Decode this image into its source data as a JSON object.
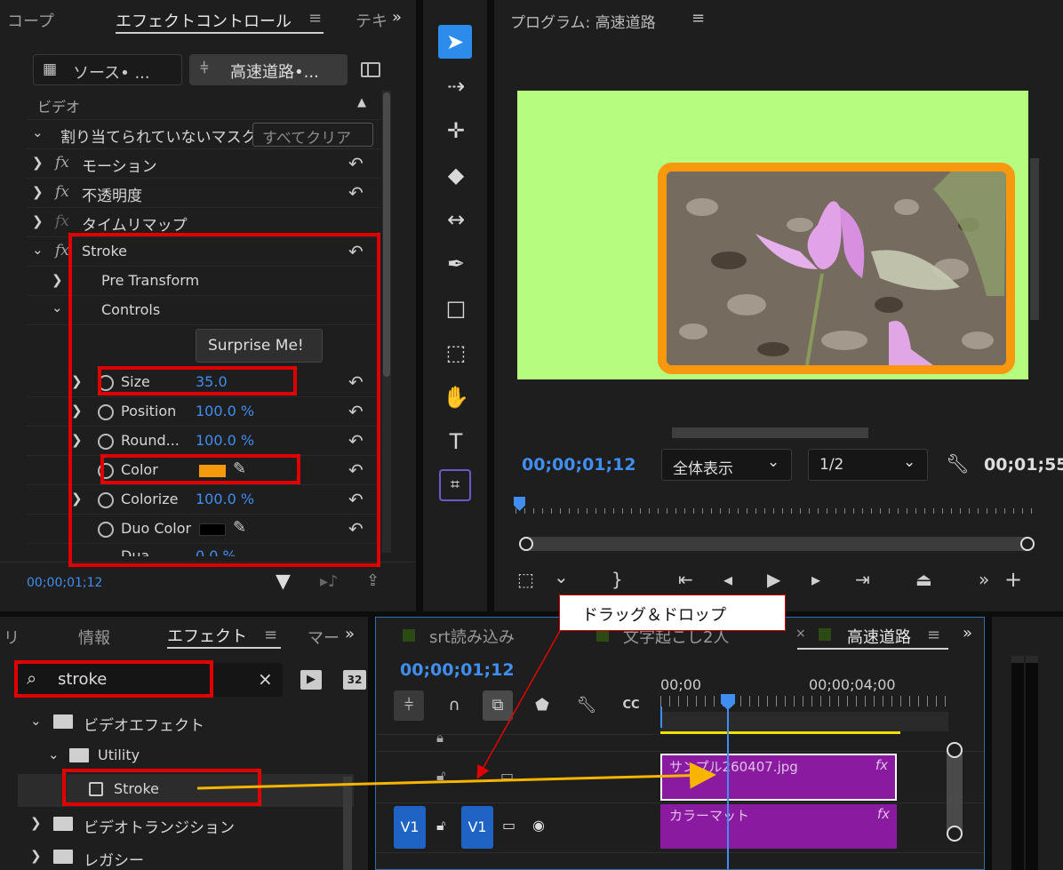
{
  "effect_controls": {
    "tabs": {
      "scope": "コープ",
      "effect_controls": "エフェクトコントロール",
      "text": "テキ"
    },
    "source_tab": "ソース• ...",
    "sequence_tab": "高速道路•...",
    "section_video": "ビデオ",
    "mask_row": "割り当てられていないマスク",
    "clear_all": "すべてクリア",
    "effects": [
      {
        "label": "モーション"
      },
      {
        "label": "不透明度"
      },
      {
        "label": "タイムリマップ"
      },
      {
        "label": "Stroke"
      }
    ],
    "fx_symbol": "fx",
    "pre_transform": "Pre Transform",
    "controls": "Controls",
    "surprise_button": "Surprise Me!",
    "params": [
      {
        "label": "Size",
        "value": "35.0"
      },
      {
        "label": "Position",
        "value": "100.0 %"
      },
      {
        "label": "Round...",
        "value": "100.0 %"
      },
      {
        "label": "Color",
        "value": ""
      },
      {
        "label": "Colorize",
        "value": "100.0 %"
      },
      {
        "label": "Duo Color",
        "value": ""
      },
      {
        "label": "Dua ",
        "value": "0.0 %"
      }
    ],
    "stroke_color": "#f59a0c",
    "duo_color": "#000000",
    "timecode": "00;00;01;12"
  },
  "program": {
    "title": "プログラム: 高速道路",
    "canvas_color": "#b6fd7f",
    "frame_color": "#f7980f",
    "timecode": "00;00;01;12",
    "zoom": "全体表示",
    "resolution": "1/2",
    "duration": "00;01;55"
  },
  "tools": [
    "selection-tool",
    "track-select-tool",
    "ripple-edit-tool",
    "razor-tool",
    "slip-tool",
    "pen-tool",
    "rectangle-tool",
    "hand-tool",
    "type-tool",
    "auto-reframe-tool"
  ],
  "effects_panel": {
    "tabs": {
      "info": "情報",
      "effects": "エフェクト",
      "markers": "マー",
      "left": "リ"
    },
    "search": "stroke",
    "badge": "32",
    "tree": [
      {
        "label": "ビデオエフェクト"
      },
      {
        "label": "Utility"
      },
      {
        "label": "Stroke"
      },
      {
        "label": "ビデオトランジション"
      },
      {
        "label": "レガシー"
      }
    ]
  },
  "timeline": {
    "tabs": [
      "srt読み込み",
      "文字起こし2人",
      "高速道路"
    ],
    "timecode": "00;00;01;12",
    "ruler": [
      "00;00",
      "00;00;04;00"
    ],
    "clips": [
      {
        "label": "サンプル260407.jpg",
        "fx": "fx"
      },
      {
        "label": "カラーマット",
        "fx": "fx"
      }
    ],
    "track_labels": [
      "V1",
      "V1"
    ]
  },
  "callout": "ドラッグ＆ドロップ"
}
